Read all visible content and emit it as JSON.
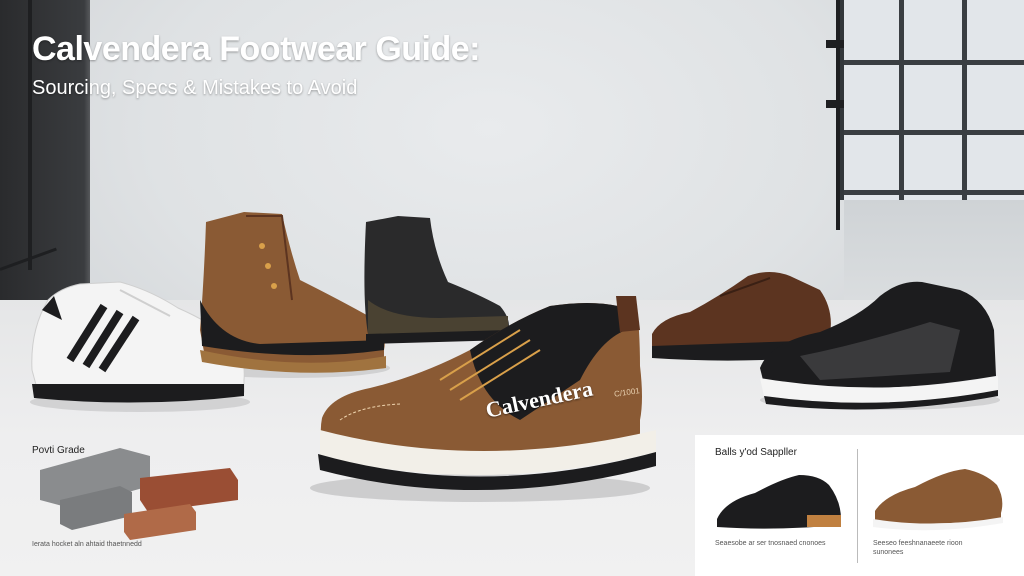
{
  "title": "Calvendera Footwear Guide:",
  "subtitle": "Sourcing, Specs & Mistakes to Avoid",
  "brand_label": "Calvendera",
  "heel_label": "C/1001",
  "left_inset": {
    "heading": "Povti Grade",
    "caption": "Ierata hocket aln ahtaid thaetnnedd"
  },
  "compare_panel": {
    "heading": "Balls y'od Sappller",
    "left_caption": "Seaesobe ar ser tnosnaed cnonoes",
    "right_caption": "Seeseo feeshnanaeete rioon sunonees"
  },
  "colors": {
    "tan_leather": "#8a5a34",
    "dark_brown": "#5c3420",
    "black": "#1c1c1e",
    "white_shoe": "#f4f4f4",
    "backdrop": "#dfe1e3"
  }
}
